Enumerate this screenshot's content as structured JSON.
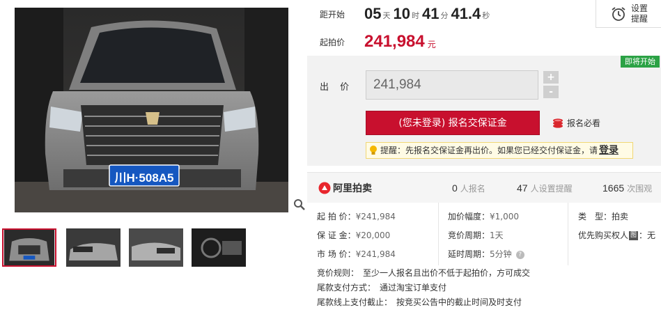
{
  "countdown": {
    "label": "距开始",
    "days": "05",
    "days_unit": "天",
    "hours": "10",
    "hours_unit": "时",
    "minutes": "41",
    "minutes_unit": "分",
    "seconds": "41.4",
    "seconds_unit": "秒"
  },
  "remind": {
    "line1": "设置",
    "line2": "提醒"
  },
  "start_price": {
    "label": "起拍价",
    "value": "241,984",
    "unit": "元"
  },
  "bid": {
    "badge": "即将开始",
    "label": "出 价",
    "input_value": "241,984",
    "plus": "+",
    "minus": "-",
    "deposit_button": "(您未登录) 报名交保证金",
    "must_read": "报名必看",
    "tip_prefix": "提醒：先报名交保证金再出价。如果您已经交付保证金，请",
    "tip_login": "登录"
  },
  "stats": {
    "brand": "阿里拍卖",
    "signups": "0",
    "signups_label": "人报名",
    "reminders": "47",
    "reminders_label": "人设置提醒",
    "views": "1665",
    "views_label": "次围观"
  },
  "info": {
    "start_price": {
      "label": "起 拍 价：",
      "value": "¥241,984"
    },
    "deposit": {
      "label": "保 证 金：",
      "value": "¥20,000"
    },
    "market_price": {
      "label": "市 场 价：",
      "value": "¥241,984"
    },
    "increment": {
      "label": "加价幅度：",
      "value": "¥1,000"
    },
    "bid_period": {
      "label": "竞价周期：",
      "value": "1天"
    },
    "extension": {
      "label": "延时周期：",
      "value": "5分钟"
    },
    "help": "?",
    "type": {
      "label": "类　型：",
      "value": "拍卖"
    },
    "priority": {
      "label": "优先购买权人",
      "tag": "图",
      "value": "：无"
    }
  },
  "rules": [
    {
      "label": "竞价规则：",
      "value": "至少一人报名且出价不低于起拍价，方可成交"
    },
    {
      "label": "尾款支付方式：",
      "value": "通过淘宝订单支付"
    },
    {
      "label": "尾款线上支付截止：",
      "value": "按竞买公告中的截止时间及时支付"
    }
  ],
  "plate": "川H·508A5",
  "colors": {
    "accent": "#c8102e",
    "badge": "#2ba245"
  },
  "icons": [
    "zoom-icon",
    "alarm-clock-icon",
    "coins-icon",
    "lightbulb-icon",
    "ali-auction-logo-icon"
  ]
}
